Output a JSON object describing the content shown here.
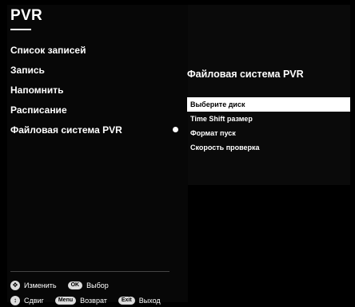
{
  "header": {
    "title": "PVR"
  },
  "menu": {
    "items": [
      {
        "label": "Список записей"
      },
      {
        "label": "Запись"
      },
      {
        "label": "Напомнить"
      },
      {
        "label": "Расписание"
      },
      {
        "label": "Файловая система PVR",
        "active": true
      }
    ]
  },
  "submenu": {
    "title": "Файловая система PVR",
    "items": [
      {
        "label": "Выберите диск",
        "selected": true
      },
      {
        "label": "Time Shift размер"
      },
      {
        "label": "Формат пуск"
      },
      {
        "label": "Скорость проверка"
      }
    ]
  },
  "footer": {
    "row1": [
      {
        "icon": "dpad-icon",
        "label": "Изменить"
      },
      {
        "icon": "ok-key",
        "key": "OK",
        "label": "Выбор"
      }
    ],
    "row2": [
      {
        "icon": "updown-icon",
        "label": "Сдвиг"
      },
      {
        "icon": "menu-key",
        "key": "Menu",
        "label": "Возврат"
      },
      {
        "icon": "exit-key",
        "key": "Exit",
        "label": "Выход"
      }
    ]
  },
  "colors": {
    "background": "#000000",
    "highlight": "#ffffff",
    "text": "#ffffff"
  }
}
